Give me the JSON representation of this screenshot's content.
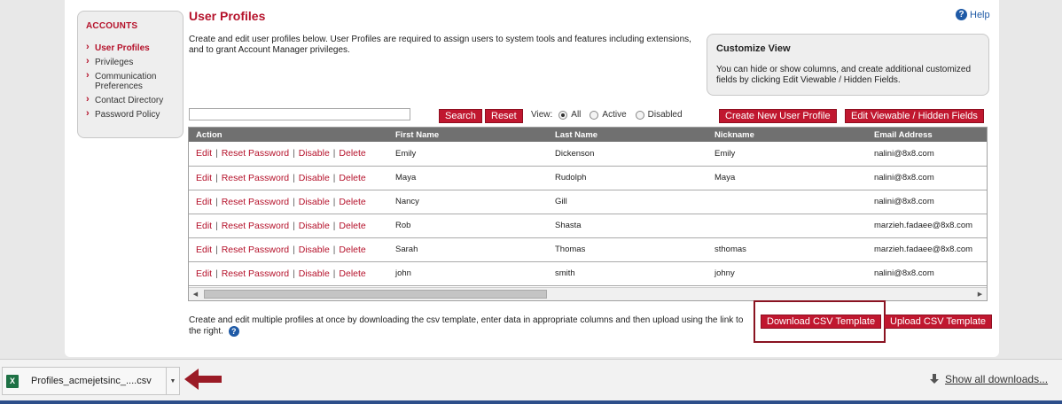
{
  "sidebar": {
    "title": "ACCOUNTS",
    "items": [
      {
        "label": "User Profiles",
        "active": true
      },
      {
        "label": "Privileges"
      },
      {
        "label": "Communication Preferences"
      },
      {
        "label": "Contact Directory"
      },
      {
        "label": "Password Policy"
      }
    ]
  },
  "header": {
    "title": "User Profiles",
    "help": "Help",
    "intro": "Create and edit user profiles below. User Profiles are required to assign users to system tools and features including extensions, and to grant Account Manager privileges."
  },
  "customize": {
    "title": "Customize View",
    "text": "You can hide or show columns, and create additional customized fields by clicking Edit Viewable / Hidden Fields."
  },
  "toolbar": {
    "search_value": "",
    "search_label": "Search",
    "reset_label": "Reset",
    "view_label": "View:",
    "view_options": [
      "All",
      "Active",
      "Disabled"
    ],
    "view_selected": "All",
    "create_label": "Create New User Profile",
    "edit_fields_label": "Edit Viewable / Hidden Fields"
  },
  "table": {
    "columns": [
      "Action",
      "First Name",
      "Last Name",
      "Nickname",
      "Email Address"
    ],
    "actions": [
      "Edit",
      "Reset Password",
      "Disable",
      "Delete"
    ],
    "rows": [
      {
        "first": "Emily",
        "last": "Dickenson",
        "nick": "Emily",
        "email": "nalini@8x8.com"
      },
      {
        "first": "Maya",
        "last": "Rudolph",
        "nick": "Maya",
        "email": "nalini@8x8.com"
      },
      {
        "first": "Nancy",
        "last": "Gill",
        "nick": "",
        "email": "nalini@8x8.com"
      },
      {
        "first": "Rob",
        "last": "Shasta",
        "nick": "",
        "email": "marzieh.fadaee@8x8.com"
      },
      {
        "first": "Sarah",
        "last": "Thomas",
        "nick": "sthomas",
        "email": "marzieh.fadaee@8x8.com"
      },
      {
        "first": "john",
        "last": "smith",
        "nick": "johny",
        "email": "nalini@8x8.com"
      }
    ]
  },
  "bulk": {
    "text": "Create and edit multiple profiles at once by downloading the csv template, enter data in appropriate columns and then upload using the link to the right.",
    "download_label": "Download CSV Template",
    "upload_label": "Upload CSV Template"
  },
  "downloads": {
    "file_name": "Profiles_acmejetsinc_....csv",
    "show_all": "Show all downloads..."
  },
  "colors": {
    "brand_red": "#c0172f",
    "title_red": "#b5122b",
    "header_gray": "#707070",
    "link_blue": "#1f5aa6"
  }
}
